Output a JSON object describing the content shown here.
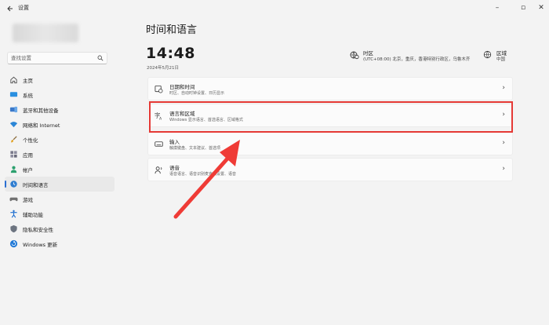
{
  "window": {
    "title": "设置"
  },
  "search": {
    "placeholder": "查找设置"
  },
  "nav": {
    "items": [
      {
        "label": "主页"
      },
      {
        "label": "系统"
      },
      {
        "label": "蓝牙和其他设备"
      },
      {
        "label": "网络和 Internet"
      },
      {
        "label": "个性化"
      },
      {
        "label": "应用"
      },
      {
        "label": "帐户"
      },
      {
        "label": "时间和语言"
      },
      {
        "label": "游戏"
      },
      {
        "label": "辅助功能"
      },
      {
        "label": "隐私和安全性"
      },
      {
        "label": "Windows 更新"
      }
    ]
  },
  "main": {
    "title": "时间和语言",
    "clock": "14:48",
    "date": "2024年5月21日",
    "timezone": {
      "title": "时区",
      "value": "(UTC+08:00) 北京，重庆，香港特别行政区，乌鲁木齐"
    },
    "region": {
      "title": "区域",
      "value": "中国"
    },
    "cards": [
      {
        "title": "日期和时间",
        "desc": "时区、自动时钟设置、日历显示"
      },
      {
        "title": "语言和区域",
        "desc": "Windows 显示语言、首选语言、区域格式"
      },
      {
        "title": "输入",
        "desc": "触摸键盘、文本建议、首选项"
      },
      {
        "title": "语音",
        "desc": "语音语言、语音识别麦克风设置、语音"
      }
    ]
  },
  "colors": {
    "highlight": "#e53935",
    "accent": "#2a6fd1"
  }
}
